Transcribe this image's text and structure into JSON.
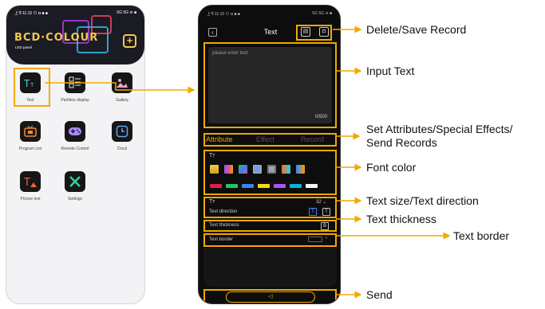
{
  "left_phone": {
    "status_time": "上午11:15 ⊙ ◘ ■ ■",
    "status_right": "5G 5G ≋ ■",
    "logo": "BCD·COLOUR",
    "logo_sub": "LED panel",
    "add_icon": "plus-icon",
    "tiles": [
      {
        "label": "Text",
        "icon": "text-icon"
      },
      {
        "label": "Partition display",
        "icon": "partition-icon"
      },
      {
        "label": "Gallery",
        "icon": "gallery-icon"
      },
      {
        "label": "Program List",
        "icon": "tv-icon"
      },
      {
        "label": "Remote Control",
        "icon": "gamepad-icon"
      },
      {
        "label": "Clock",
        "icon": "clock-icon"
      },
      {
        "label": "Picture text",
        "icon": "picture-text-icon"
      },
      {
        "label": "Settings",
        "icon": "wrench-icon"
      }
    ]
  },
  "right_phone": {
    "status_time": "上午11:15 ⊙ ◘ ■ ■",
    "status_right": "5G 5G ≋ ■",
    "title": "Text",
    "input_placeholder": "please enter text",
    "counter": "0/500",
    "tabs": [
      "Attribute",
      "Effect",
      "Record"
    ],
    "size_value": "32 ⌄",
    "text_direction_label": "Text direction",
    "text_thickness_label": "Text thickness",
    "text_border_label": "Text border",
    "tt_glyph": "Tт",
    "bold_glyph": "B",
    "send_glyph": "◁",
    "chevron_glyph": "›",
    "font_swatches": [
      "#d4a017",
      "#8b5cf6",
      "#22c55e",
      "#60a5fa",
      "#a3a3a3",
      "#f97316",
      "#3b82f6"
    ],
    "font_colors": [
      "#e11d48",
      "#22c55e",
      "#3b82f6",
      "#f5d90a",
      "#a855f7",
      "#06b6d4",
      "#f5f5f5"
    ]
  },
  "annotations": {
    "delete_save": "Delete/Save Record",
    "input_text": "Input Text",
    "set_attributes_1": "Set Attributes/Special Effects/",
    "set_attributes_2": "Send Records",
    "font_color": "Font color",
    "text_size_direction": "Text size/Text direction",
    "text_thickness": "Text thickness",
    "text_border": "Text border",
    "send": "Send"
  },
  "colors": {
    "highlight": "#f2a900",
    "arrow": "#f2a900"
  }
}
